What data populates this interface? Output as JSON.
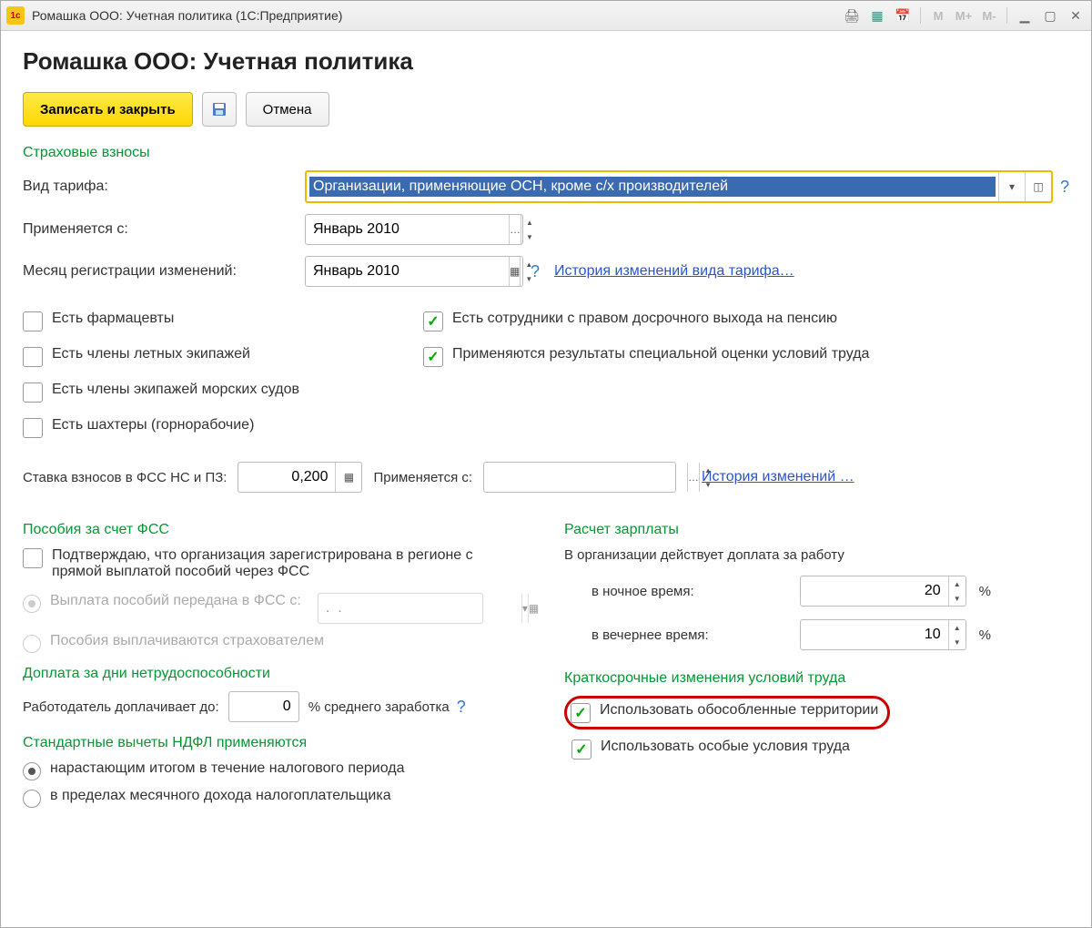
{
  "title_bar": "Ромашка ООО: Учетная политика  (1С:Предприятие)",
  "page_title": "Ромашка ООО: Учетная политика",
  "toolbar": {
    "save_close": "Записать и закрыть",
    "cancel": "Отмена"
  },
  "sections": {
    "insurance": "Страховые взносы",
    "fss": "Пособия за счет ФСС",
    "sick_pay": "Доплата за дни нетрудоспособности",
    "ndfl": "Стандартные вычеты НДФЛ применяются",
    "salary": "Расчет зарплаты",
    "shortterm": "Краткосрочные изменения условий труда"
  },
  "labels": {
    "tariff": "Вид тарифа:",
    "applies_from": "Применяется с:",
    "reg_month": "Месяц регистрации изменений:",
    "rate_fss": "Ставка взносов в ФСС НС и ПЗ:",
    "applies_from2": "Применяется с:",
    "employer_pays": "Работодатель доплачивает до:",
    "avg_earn": "% среднего заработка",
    "org_pays": "В организации действует доплата за работу",
    "night": "в ночное время:",
    "evening": "в вечернее время:",
    "pct": "%"
  },
  "values": {
    "tariff": "Организации, применяющие ОСН, кроме с/х производителей",
    "applies_from": "Январь 2010",
    "reg_month": "Январь 2010",
    "rate_fss": "0,200",
    "applies_from2": "",
    "employer_pays": "0",
    "fss_date": ".  .",
    "night": "20",
    "evening": "10"
  },
  "links": {
    "tariff_history": "История изменений вида тарифа…",
    "history": "История изменений …"
  },
  "checks": {
    "pharm": "Есть фармацевты",
    "flight": "Есть члены летных экипажей",
    "sea": "Есть члены экипажей морских судов",
    "miners": "Есть шахтеры (горнорабочие)",
    "early_pension": "Есть сотрудники с правом досрочного выхода на пенсию",
    "spec_eval": "Применяются результаты специальной оценки условий труда",
    "fss_confirm": "Подтверждаю, что организация зарегистрирована в регионе с прямой выплатой пособий через ФСС",
    "territories": "Использовать обособленные территории",
    "conditions": "Использовать особые условия труда"
  },
  "radios": {
    "fss_transfer": "Выплата пособий передана в ФСС с:",
    "fss_insurer": "Пособия выплачиваются страхователем",
    "ndfl_cumulative": "нарастающим итогом в течение налогового периода",
    "ndfl_monthly": "в пределах месячного дохода налогоплательщика"
  }
}
